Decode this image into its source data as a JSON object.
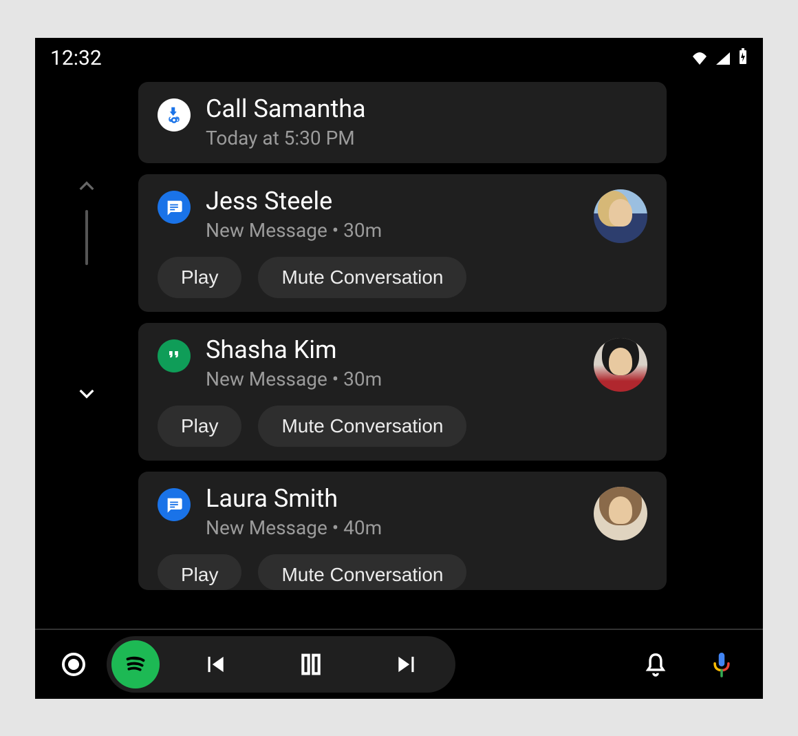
{
  "status": {
    "time": "12:32",
    "icons": {
      "wifi": "wifi-icon",
      "signal": "signal-icon",
      "battery": "battery-icon"
    }
  },
  "scroll": {
    "up": "up",
    "down": "down"
  },
  "cards": [
    {
      "app_icon": "reminder-icon",
      "app_icon_bg": "icon-reminder",
      "title": "Call Samantha",
      "subtitle": "Today at 5:30 PM",
      "has_avatar": false,
      "has_actions": false
    },
    {
      "app_icon": "messages-icon",
      "app_icon_bg": "icon-messages",
      "title": "Jess Steele",
      "subtitle": "New Message • 30m",
      "has_avatar": true,
      "avatar_class": "a1",
      "has_actions": true,
      "actions": {
        "play": "Play",
        "mute": "Mute Conversation"
      }
    },
    {
      "app_icon": "hangouts-icon",
      "app_icon_bg": "icon-hangouts",
      "title": "Shasha Kim",
      "subtitle": "New Message • 30m",
      "has_avatar": true,
      "avatar_class": "a2",
      "has_actions": true,
      "actions": {
        "play": "Play",
        "mute": "Mute Conversation"
      }
    },
    {
      "app_icon": "messages-icon",
      "app_icon_bg": "icon-messages",
      "title": "Laura Smith",
      "subtitle": "New Message • 40m",
      "has_avatar": true,
      "avatar_class": "a3",
      "has_actions": true,
      "cut": true,
      "actions": {
        "play": "Play",
        "mute": "Mute Conversation"
      }
    }
  ],
  "nav": {
    "home": "home",
    "spotify": "spotify",
    "prev": "previous-track",
    "pause": "pause",
    "next": "next-track",
    "bell": "notifications",
    "mic": "voice"
  }
}
